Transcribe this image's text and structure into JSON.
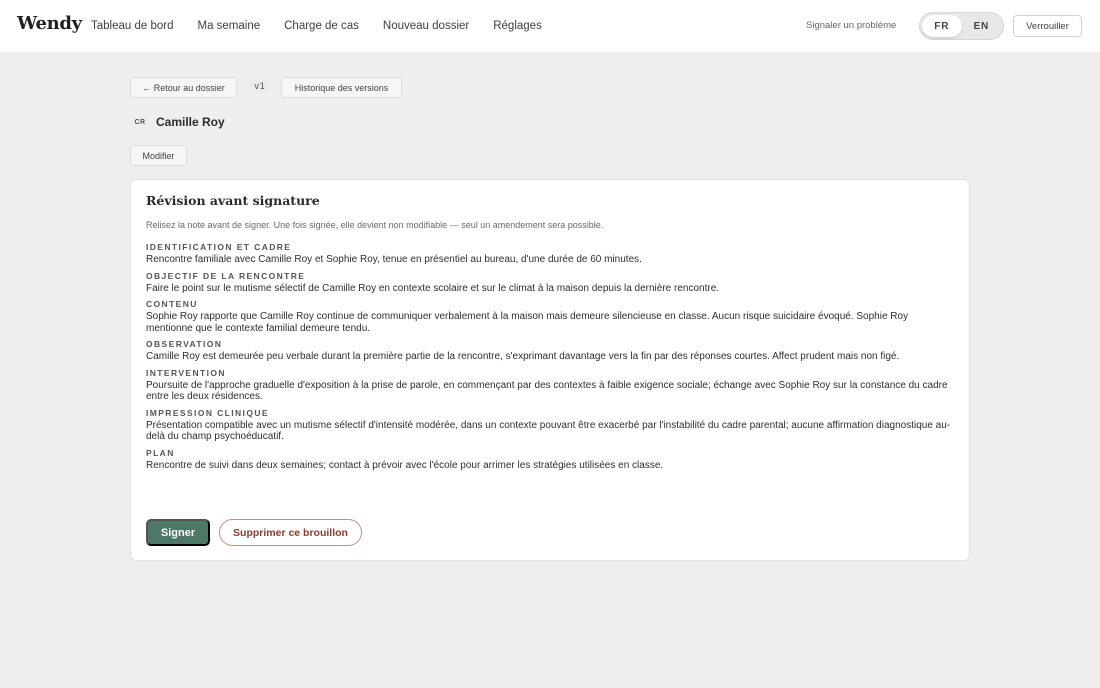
{
  "app": {
    "logo": "Wendy"
  },
  "nav": {
    "items": [
      {
        "label": "Tableau de bord"
      },
      {
        "label": "Ma semaine"
      },
      {
        "label": "Charge de cas"
      },
      {
        "label": "Nouveau dossier"
      },
      {
        "label": "Réglages"
      }
    ]
  },
  "header": {
    "report_label": "Signaler un problème",
    "languages": [
      "FR",
      "EN"
    ],
    "active_language": "FR",
    "lock_label": "Verrouiller"
  },
  "toolbar": {
    "back_label": "← Retour au dossier",
    "version": "v1",
    "history_label": "Historique des versions"
  },
  "client": {
    "initials": "CR",
    "name": "Camille Roy",
    "edit_label": "Modifier"
  },
  "card": {
    "title": "Révision avant signature",
    "hint": "Relisez la note avant de signer. Une fois signée, elle devient non modifiable — seul un amendement sera possible.",
    "sections": [
      {
        "label": "Identification et cadre",
        "body": "Rencontre familiale avec Camille Roy et Sophie Roy, tenue en présentiel au bureau, d'une durée de 60 minutes."
      },
      {
        "label": "Objectif de la rencontre",
        "body": "Faire le point sur le mutisme sélectif de Camille Roy en contexte scolaire et sur le climat à la maison depuis la dernière rencontre."
      },
      {
        "label": "Contenu",
        "body": "Sophie Roy rapporte que Camille Roy continue de communiquer verbalement à la maison mais demeure silencieuse en classe. Aucun risque suicidaire évoqué. Sophie Roy mentionne que le contexte familial demeure tendu."
      },
      {
        "label": "Observation",
        "body": "Camille Roy est demeurée peu verbale durant la première partie de la rencontre, s'exprimant davantage vers la fin par des réponses courtes. Affect prudent mais non figé."
      },
      {
        "label": "Intervention",
        "body": "Poursuite de l'approche graduelle d'exposition à la prise de parole, en commençant par des contextes à faible exigence sociale; échange avec Sophie Roy sur la constance du cadre entre les deux résidences."
      },
      {
        "label": "Impression clinique",
        "body": "Présentation compatible avec un mutisme sélectif d'intensité modérée, dans un contexte pouvant être exacerbé par l'instabilité du cadre parental; aucune affirmation diagnostique au-delà du champ psychoéducatif."
      },
      {
        "label": "Plan",
        "body": "Rencontre de suivi dans deux semaines; contact à prévoir avec l'école pour arrimer les stratégies utilisées en classe."
      }
    ],
    "sign_label": "Signer",
    "delete_label": "Supprimer ce brouillon"
  },
  "colors": {
    "accent_green": "#4d7866",
    "danger_text": "#8b3a2f",
    "background": "#efeeec"
  }
}
